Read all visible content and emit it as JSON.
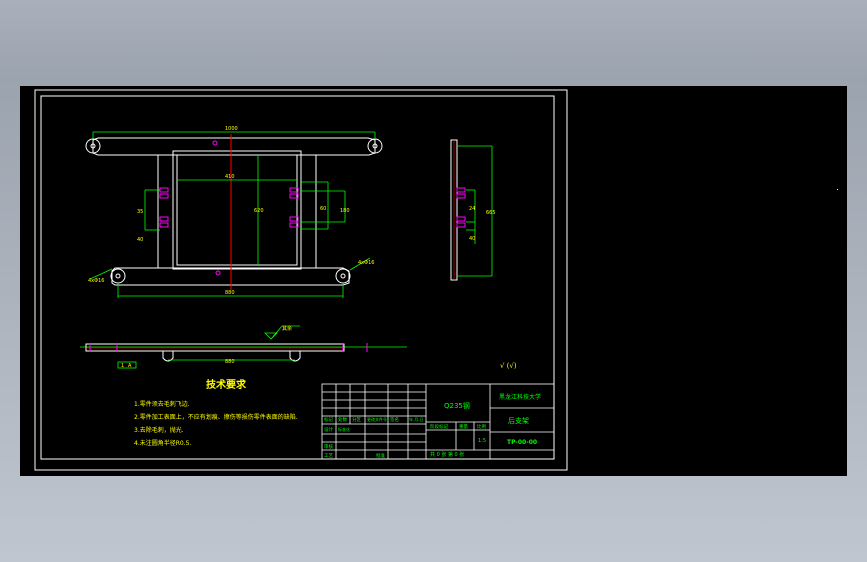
{
  "drawing": {
    "dimensions": {
      "top_overall": "1000",
      "bottom_overall": "880",
      "inner_width": "410",
      "inner_height": "620",
      "bracket_span": "180",
      "bracket_small": "60",
      "left_dim_top": "35",
      "left_dim_bottom": "40",
      "side_height": "665",
      "side_upper": "24",
      "side_lower": "40",
      "bottom_view_center": "880",
      "hole_note_left": "4xΦ16",
      "hole_note_right": "4xΦ16",
      "detail_box_label": "1",
      "leader_label": "A",
      "surface_leader": "其余"
    },
    "roughness_note": "√ (√)",
    "tech_requirements": {
      "title": "技术要求",
      "items": [
        "1.零件须去毛刺飞边.",
        "2.零件加工表面上，不应有划痕、擦伤等损伤零件表面的缺陷.",
        "3.去除毛刺，抛光.",
        "4.未注圆角半径R0.5."
      ]
    },
    "title_block": {
      "material": "Q235钢",
      "school": "黑龙江科技大学",
      "part_name": "后支架",
      "drawing_no": "TP-00-00",
      "scale": "1:5",
      "sheet_info": "共 0 张   第 0 张",
      "headers": [
        "标记",
        "处数",
        "分区",
        "更改文件号",
        "签名",
        "年.月.日"
      ],
      "roles": [
        "设计",
        "标准化",
        "审核",
        "工艺",
        "批准"
      ],
      "stage_labels": [
        "阶段标记",
        "重量",
        "比例"
      ]
    }
  }
}
